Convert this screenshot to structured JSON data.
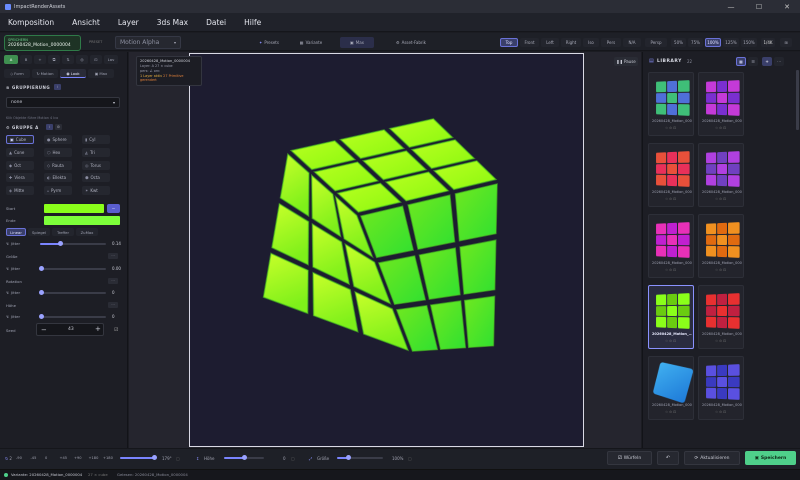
{
  "window": {
    "title": "ImpactRenderAssets",
    "minimize": "—",
    "maximize": "☐",
    "close": "✕"
  },
  "menu": [
    "Komposition",
    "Ansicht",
    "Layer",
    "3ds Max",
    "Datei",
    "Hilfe"
  ],
  "toolbar": {
    "badge_top": "SPEICHERN",
    "badge_name": "20260428_Motion_0000004",
    "preset_label": "PRESET",
    "preset_value": "Motion Alpha",
    "tabs": [
      "Presets",
      "Variante",
      "Max",
      "Asset-Fabrik"
    ],
    "views": [
      "Top",
      "Front",
      "Left",
      "Right",
      "Iso",
      "Pers",
      "N/A",
      "Persp"
    ],
    "zooms": [
      "50%",
      "75%",
      "100%",
      "125%",
      "150%",
      "1/4K"
    ]
  },
  "left": {
    "tabs_row1": [
      "A",
      "B"
    ],
    "tabs_row1_right": "Lav",
    "tabs_row2": [
      "Form",
      "Motion",
      "Look",
      "Max"
    ],
    "group_title": "GRUPPIERUNG",
    "group_value": "none",
    "group_hint": "Klik Objekte führe Motion 4 Ico",
    "groupA_title": "GRUPPE A",
    "shapes": [
      "Cube",
      "Sphere",
      "Cyl",
      "Cone",
      "Hex",
      "Tri",
      "Oct",
      "Rauta",
      "Torus",
      "Viera",
      "Ellekta",
      "Octa",
      "Mitte",
      "Pyrm",
      "Kwt"
    ],
    "start_label": "Start",
    "end_label": "Ende",
    "interp_tabs": [
      "Linear",
      "Spiegel",
      "Treffer",
      "ZuMax"
    ],
    "param_rows": [
      {
        "label": "Jitter",
        "value": "0.14",
        "fill": 0.3
      },
      {
        "label": "Größe",
        "value": "",
        "fill": 0
      },
      {
        "label": "Jitter",
        "value": "0.00",
        "fill": 0.02
      },
      {
        "label": "Rotation",
        "value": "",
        "fill": 0
      },
      {
        "label": "Jitter",
        "value": "0",
        "fill": 0.02
      },
      {
        "label": "Höhe",
        "value": "",
        "fill": 0
      },
      {
        "label": "Jitter",
        "value": "0",
        "fill": 0.02
      }
    ],
    "seed_label": "Seed",
    "seed_value": "43",
    "start_color": "#8aff1a",
    "end_color": "#7dff3a"
  },
  "viewport": {
    "info_name": "20260428_Motion_0000004",
    "info_l2": "Layer: A   27 × cube",
    "info_l3": "pers: ∠  orn:",
    "info_l4a": "1 Layer aktiv",
    "info_l4b": "27 Primitive gerendert",
    "pause_label": "Pause"
  },
  "library": {
    "title": "LIBRARY",
    "count": "22",
    "cards": [
      {
        "name": "20260428_Motion_000...",
        "c1": "#3fbf78",
        "c2": "#4f6fd8"
      },
      {
        "name": "20260428_Motion_000...",
        "c1": "#c43ad8",
        "c2": "#7a2fd0"
      },
      {
        "name": "20260428_Motion_000...",
        "c1": "#e8503a",
        "c2": "#e8305a"
      },
      {
        "name": "20260428_Motion_000...",
        "c1": "#b040e0",
        "c2": "#7040c0"
      },
      {
        "name": "20260428_Motion_000...",
        "c1": "#e830b8",
        "c2": "#c020d0"
      },
      {
        "name": "20260428_Motion_000...",
        "c1": "#f09020",
        "c2": "#e06a10"
      },
      {
        "name": "20260428_Motion_...",
        "c1": "#8aff1a",
        "c2": "#6acc10"
      },
      {
        "name": "20260428_Motion_000...",
        "c1": "#e83030",
        "c2": "#c02040"
      },
      {
        "name": "20260428_Motion_000...",
        "c1": "#1e7ad8",
        "c2": "#40b0f0"
      },
      {
        "name": "20260428_Motion_000...",
        "c1": "#5a50e0",
        "c2": "#3a3ac0"
      }
    ]
  },
  "bottom": {
    "frame_a": "2",
    "frames": [
      "-90",
      "-45",
      "0",
      "+45",
      "+90",
      "+180",
      "+180"
    ],
    "rot_value": "179°",
    "hoehe_label": "Höhe",
    "hoehe_value": "0",
    "groesse_label": "Größe",
    "groesse_value": "100%",
    "wuerfeln": "Würfeln",
    "aktualisieren": "Aktualisieren",
    "speichern": "Speichern"
  },
  "status": {
    "variante": "Variante: 20260428_Motion_0000004",
    "cubes": "27 × cube",
    "selected": "Gelesen: 20260428_Motion_0000004"
  },
  "colors": {
    "accent": "#6a72d8",
    "cube": "#8aff1a",
    "save": "#4fd08a"
  }
}
